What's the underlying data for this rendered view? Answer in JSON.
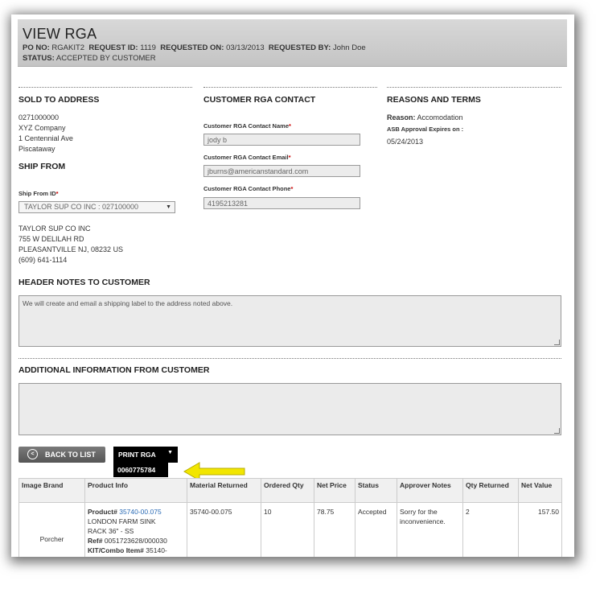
{
  "header": {
    "title": "VIEW RGA",
    "po_label": "PO NO:",
    "po_value": "RGAKIT2",
    "request_id_label": "REQUEST ID:",
    "request_id_value": "1119",
    "requested_on_label": "REQUESTED ON:",
    "requested_on_value": "03/13/2013",
    "requested_by_label": "REQUESTED BY:",
    "requested_by_value": "John Doe",
    "status_label": "STATUS:",
    "status_value": "ACCEPTED BY CUSTOMER"
  },
  "sold_to": {
    "title": "SOLD TO ADDRESS",
    "lines": [
      "0271000000",
      "XYZ Company",
      "1 Centennial Ave",
      "Piscataway"
    ]
  },
  "ship_from": {
    "title": "SHIP FROM",
    "id_label": "Ship From ID",
    "id_value": "TAYLOR SUP CO INC : 027100000",
    "lines": [
      "TAYLOR SUP CO INC",
      "755 W DELILAH RD",
      "PLEASANTVILLE NJ, 08232 US",
      "(609) 641-1114"
    ]
  },
  "contact": {
    "title": "CUSTOMER RGA CONTACT",
    "name_label": "Customer RGA Contact Name",
    "name_value": "jody b",
    "email_label": "Customer RGA Contact Email",
    "email_value": "jburns@americanstandard.com",
    "phone_label": "Customer RGA Contact Phone",
    "phone_value": "4195213281",
    "required_mark": "*"
  },
  "reasons": {
    "title": "REASONS AND TERMS",
    "reason_label": "Reason:",
    "reason_value": "Accomodation",
    "approval_label": "ASB Approval Expires on :",
    "approval_value": "05/24/2013"
  },
  "header_notes": {
    "title": "HEADER NOTES TO CUSTOMER",
    "text": "We will create and email a shipping label to the address noted above."
  },
  "additional_info": {
    "title": "ADDITIONAL INFORMATION FROM CUSTOMER",
    "text": ""
  },
  "actions": {
    "back_label": "BACK TO LIST",
    "print_label": "PRINT RGA",
    "print_option": "0060775784"
  },
  "table": {
    "columns": [
      "Image Brand",
      "Product Info",
      "Material Returned",
      "Ordered Qty",
      "Net Price",
      "Status",
      "Approver Notes",
      "Qty Returned",
      "Net Value"
    ],
    "rows": [
      {
        "brand": "Porcher",
        "product_label": "Product#",
        "product_link": "35740-00.075",
        "product_name1": "LONDON FARM SINK",
        "product_name2": "RACK 36\" - SS",
        "ref_label": "Ref#",
        "ref_value": "0051723628/000030",
        "kit_label": "KIT/Combo Item#",
        "kit_value": "35140-",
        "material_returned": "35740-00.075",
        "ordered_qty": "10",
        "net_price": "78.75",
        "status": "Accepted",
        "approver_notes1": "Sorry for the",
        "approver_notes2": "inconvenience.",
        "qty_returned": "2",
        "net_value": "157.50"
      }
    ]
  },
  "colors": {
    "arrow": "#f2e600",
    "link": "#2a6bb5",
    "required": "#cc0000"
  }
}
